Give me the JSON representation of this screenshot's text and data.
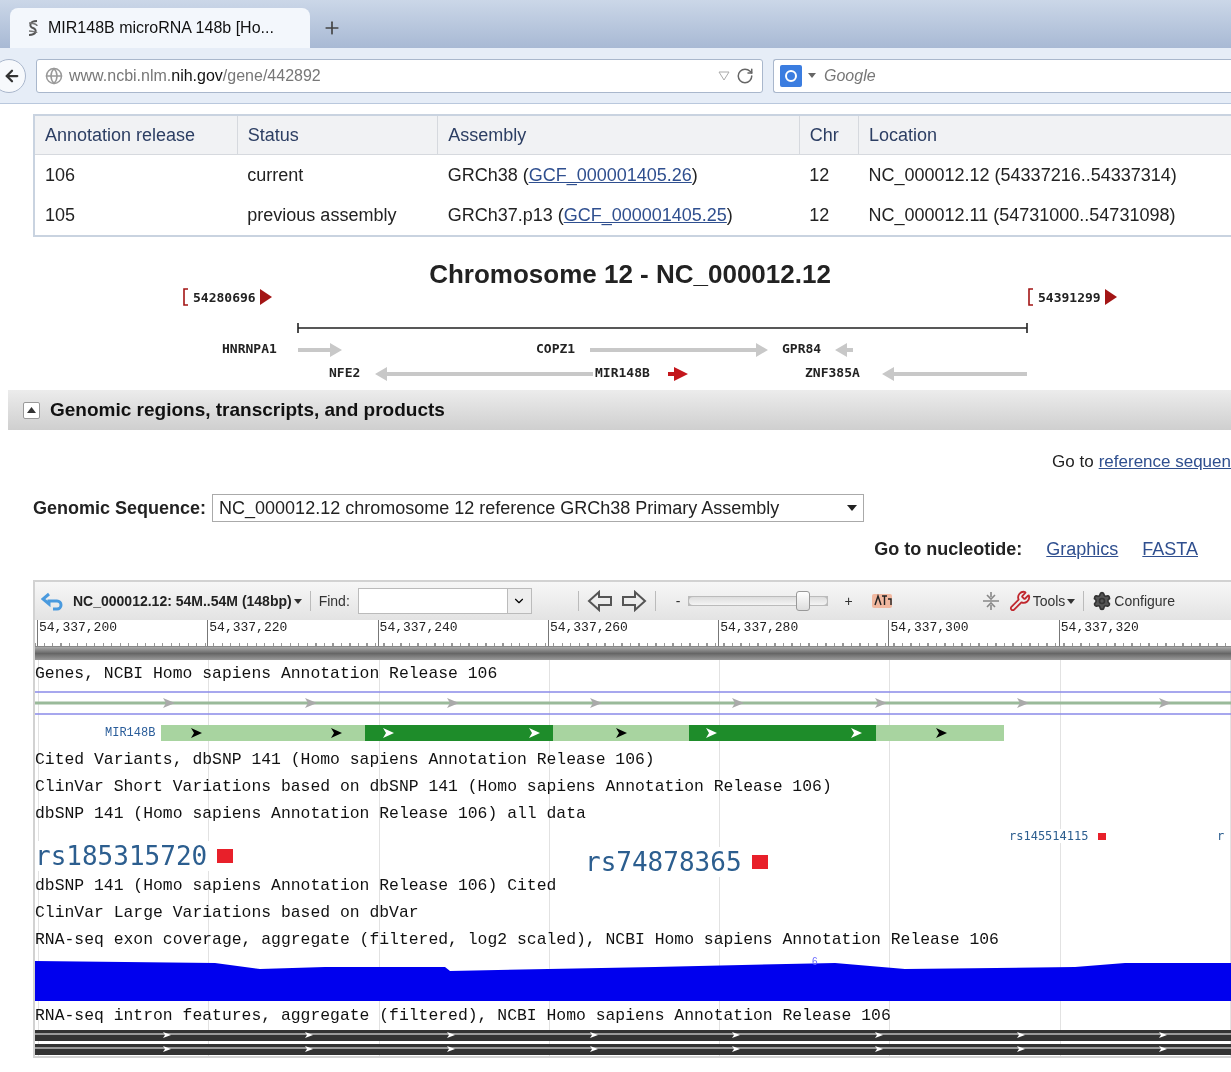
{
  "browser": {
    "tab": {
      "title": "MIR148B microRNA 148b [Ho...",
      "selected": true
    },
    "url": "www.ncbi.nlm.**nih.gov**/gene/442892",
    "search": {
      "placeholder": "Google"
    }
  },
  "annotation_table": {
    "columns": [
      "Annotation release",
      "Status",
      "Assembly",
      "Chr",
      "Location"
    ],
    "rows": [
      {
        "release": "106",
        "status": "current",
        "assembly": {
          "before": "GRCh38 (",
          "link": "GCF_000001405.26",
          "after": ")"
        },
        "chr": "12",
        "location": "NC_000012.12 (54337216..54337314)"
      },
      {
        "release": "105",
        "status": "previous assembly",
        "assembly": {
          "before": "GRCh37.p13 (",
          "link": "GCF_000001405.25",
          "after": ")"
        },
        "chr": "12",
        "location": "NC_000012.11 (54731000..54731098)"
      }
    ]
  },
  "chromosome": {
    "title": "Chromosome 12 - NC_000012.12",
    "start": "54280696",
    "end": "54391299",
    "genes": [
      {
        "label": "HNRNPA1",
        "kind": "forward",
        "selected": false
      },
      {
        "label": "COPZ1",
        "kind": "forward",
        "selected": false
      },
      {
        "label": "GPR84",
        "kind": "reverse",
        "selected": false
      },
      {
        "label": "NFE2",
        "kind": "reverse",
        "selected": false
      },
      {
        "label": "MIR148B",
        "kind": "forward",
        "selected": true
      },
      {
        "label": "ZNF385A",
        "kind": "reverse",
        "selected": false
      }
    ]
  },
  "section": {
    "title": "Genomic regions, transcripts, and products",
    "expanded": true
  },
  "goto_reference": {
    "text": "Go to",
    "link": "reference sequen"
  },
  "genomic_sequence": {
    "label": "Genomic Sequence:",
    "value": "NC_000012.12 chromosome 12 reference GRCh38 Primary Assembly"
  },
  "goto_nucleotide": {
    "label": "Go to nucleotide:",
    "links": [
      "Graphics",
      "FASTA"
    ]
  },
  "viewer": {
    "toolbar": {
      "region": "NC_000012.12: 54M..54M (148bp)",
      "find_label": "Find:",
      "zoom": {
        "minus": "-",
        "plus": "+",
        "level": 0.85
      },
      "tools": "Tools",
      "configure": "Configure"
    },
    "ruler": [
      "54,337,200",
      "54,337,220",
      "54,337,240",
      "54,337,260",
      "54,337,280",
      "54,337,300",
      "54,337,320"
    ],
    "tracks": [
      {
        "kind": "label",
        "text": "Genes, NCBI Homo sapiens Annotation Release 106"
      },
      {
        "kind": "gene_lines"
      },
      {
        "kind": "gene_model",
        "label": "MIR148B"
      },
      {
        "kind": "label",
        "text": "Cited Variants, dbSNP 141 (Homo sapiens Annotation Release 106)"
      },
      {
        "kind": "label",
        "text": "ClinVar Short Variations based on dbSNP 141 (Homo sapiens Annotation Release 106)"
      },
      {
        "kind": "label",
        "text": "dbSNP 141 (Homo sapiens Annotation Release 106) all data"
      },
      {
        "kind": "snps",
        "items": [
          {
            "label": "rs185315720",
            "kind": "large"
          },
          {
            "label": "rs74878365",
            "kind": "large"
          },
          {
            "label": "rs145514115",
            "kind": "small"
          },
          {
            "label": "r",
            "kind": "small"
          }
        ]
      },
      {
        "kind": "label",
        "text": "dbSNP 141 (Homo sapiens Annotation Release 106) Cited"
      },
      {
        "kind": "label",
        "text": "ClinVar Large Variations based on dbVar"
      },
      {
        "kind": "label",
        "text": "RNA-seq exon coverage, aggregate (filtered, log2 scaled), NCBI Homo sapiens Annotation Release 106"
      },
      {
        "kind": "coverage",
        "scale_label": "6"
      },
      {
        "kind": "label",
        "text": "RNA-seq intron features, aggregate (filtered), NCBI Homo sapiens Annotation Release 106"
      },
      {
        "kind": "introns"
      }
    ]
  }
}
